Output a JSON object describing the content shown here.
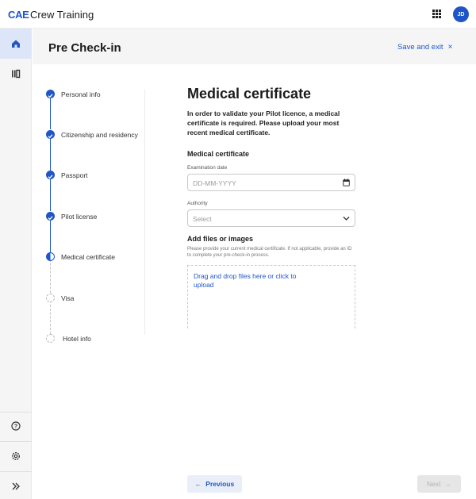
{
  "topbar": {
    "logo": "CAE",
    "app_title": "Crew Training",
    "apps_icon": "grid-apps-icon",
    "avatar_initials": "JD"
  },
  "rail": {
    "items": [
      {
        "name": "home-icon",
        "active": true
      },
      {
        "name": "library-icon",
        "active": false
      }
    ],
    "bottom_items": [
      {
        "name": "help-icon"
      },
      {
        "name": "settings-icon"
      },
      {
        "name": "expand-icon"
      }
    ]
  },
  "header": {
    "title": "Pre Check-in",
    "save_exit_label": "Save and exit",
    "close_glyph": "×"
  },
  "steps": [
    {
      "label": "Personal info",
      "state": "done"
    },
    {
      "label": "Citizenship and residency",
      "state": "done"
    },
    {
      "label": "Passport",
      "state": "done"
    },
    {
      "label": "Pilot license",
      "state": "done"
    },
    {
      "label": "Medical certificate",
      "state": "current"
    },
    {
      "label": "Visa",
      "state": "todo"
    },
    {
      "label": "Hotel info",
      "state": "todo"
    }
  ],
  "form": {
    "heading": "Medical certificate",
    "intro": "In order to validate your Pilot licence, a medical certificate is required. Please upload your most recent medical certificate.",
    "section_title": "Medical certificate",
    "exam_date_label": "Examination date",
    "exam_date_placeholder": "DD-MM-YYYY",
    "authority_label": "Authority",
    "authority_placeholder": "Select",
    "files_title": "Add files or images",
    "files_hint": "Please provide your current medical certificate. If not applicable, provide an ID to complete your pre-check-in process.",
    "dropzone_text": "Drag and drop files here or click to upload"
  },
  "footer": {
    "prev_label": "Previous",
    "prev_arrow": "←",
    "next_label": "Next",
    "next_arrow": "→"
  },
  "colors": {
    "accent": "#1f56c7",
    "rail_bg": "#f5f5f5",
    "active_rail": "#dde6f8"
  }
}
